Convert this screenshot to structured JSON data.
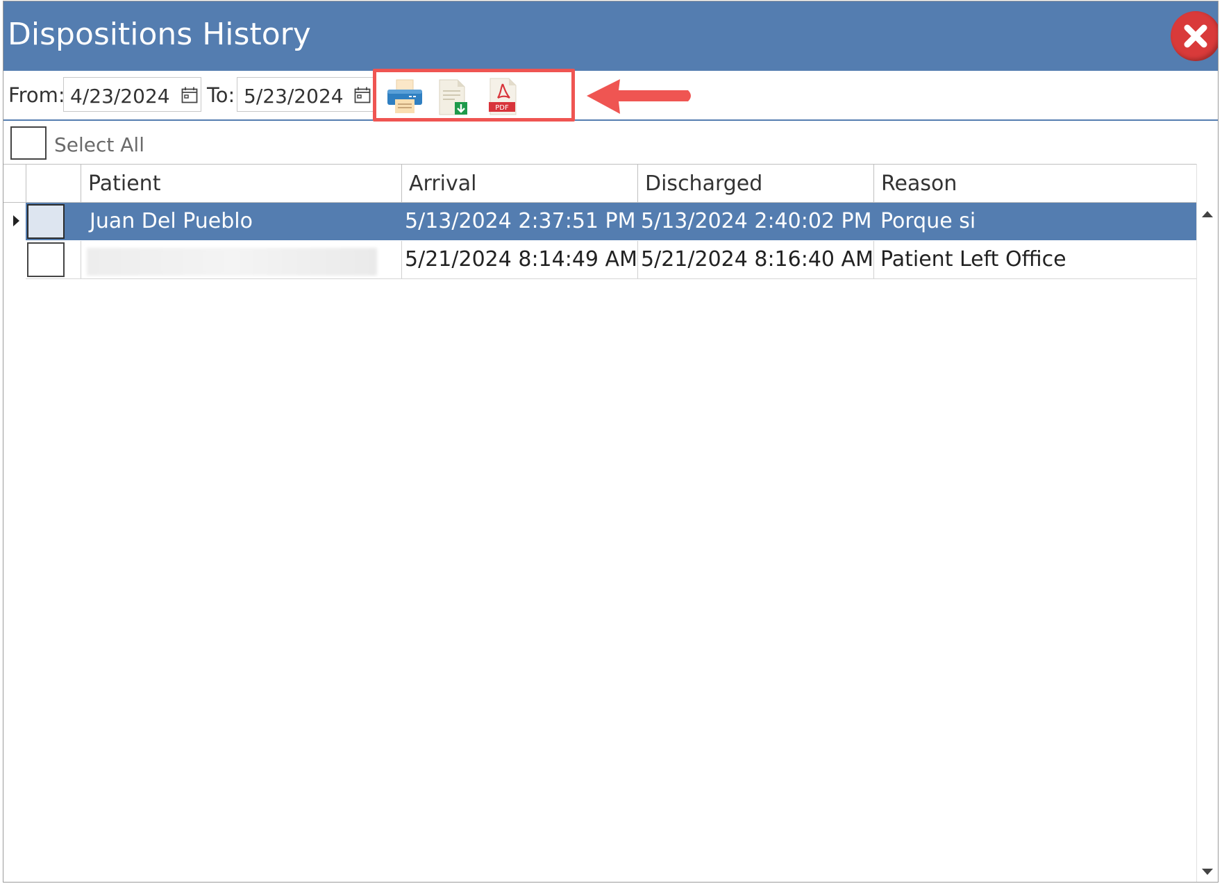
{
  "window": {
    "title": "Dispositions History",
    "title_bar_color": "#547db0",
    "close_icon": "close-x-icon"
  },
  "toolbar": {
    "from_label": "From:",
    "from_value": "4/23/2024",
    "to_label": "To:",
    "to_value": "5/23/2024",
    "calendar_icon": "calendar-icon",
    "actions": [
      {
        "name": "print",
        "icon": "printer-icon"
      },
      {
        "name": "export",
        "icon": "document-download-icon"
      },
      {
        "name": "pdf",
        "icon": "pdf-icon",
        "badge": "PDF"
      }
    ],
    "annotation_color": "#ef5552"
  },
  "select_all": {
    "label": "Select All",
    "checked": false
  },
  "grid": {
    "columns": [
      "Patient",
      "Arrival",
      "Discharged",
      "Reason"
    ],
    "rows": [
      {
        "selected": true,
        "patient": "Juan Del Pueblo",
        "arrival": "5/13/2024 2:37:51 PM",
        "discharged": "5/13/2024 2:40:02 PM",
        "reason": "Porque si"
      },
      {
        "selected": false,
        "patient": "",
        "patient_redacted": true,
        "arrival": "5/21/2024 8:14:49 AM",
        "discharged": "5/21/2024 8:16:40 AM",
        "reason": "Patient Left Office"
      }
    ],
    "selection_color": "#547db0"
  }
}
